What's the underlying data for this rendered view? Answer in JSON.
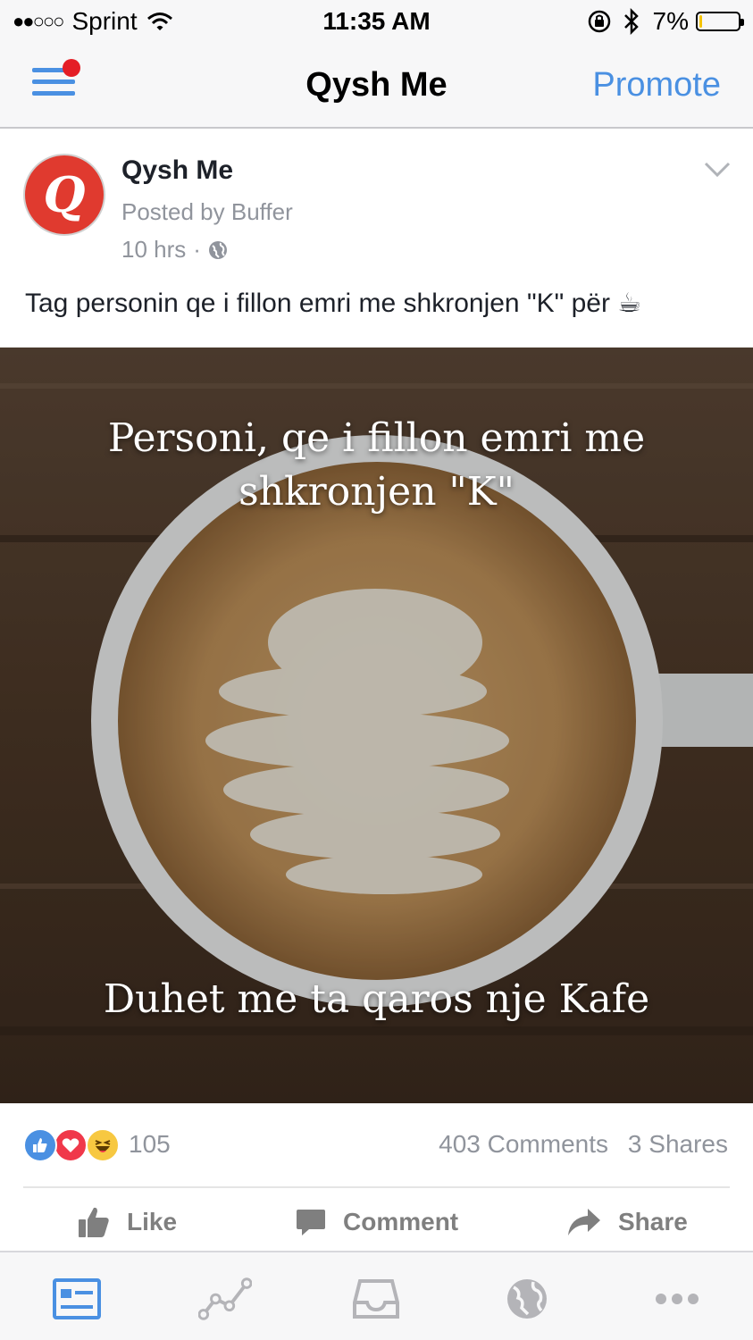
{
  "status_bar": {
    "signal": "●●○○○",
    "carrier": "Sprint",
    "time": "11:35 AM",
    "battery_text": "7%",
    "battery_level": 0.07,
    "icons": [
      "wifi-icon",
      "rotation-lock-icon",
      "bluetooth-icon",
      "battery-icon"
    ]
  },
  "nav": {
    "title": "Qysh Me",
    "action": "Promote",
    "menu_icon": "menu-icon",
    "notification_color": "#e41e26"
  },
  "post": {
    "page_avatar_letter": "Q",
    "page_name": "Qysh Me",
    "posted_by": "Posted by Buffer",
    "time": "10 hrs",
    "separator": "·",
    "privacy_icon": "globe-icon",
    "options_icon": "chevron-down-icon",
    "text": "Tag personin qe i fillon emri me shkronjen \"K\" për ☕",
    "image_text_top_line1": "Personi, qe i fillon emri me",
    "image_text_top_line2": "shkronjen \"K\"",
    "image_text_bottom": "Duhet me ta qaros nje Kafe"
  },
  "engagement": {
    "reaction_icons": [
      "like-reaction-icon",
      "love-reaction-icon",
      "haha-reaction-icon"
    ],
    "reaction_count": "105",
    "comments": "403 Comments",
    "shares": "3 Shares"
  },
  "actions": {
    "like": "Like",
    "comment": "Comment",
    "share": "Share"
  },
  "tab_bar": {
    "tabs": [
      "news-feed-icon",
      "insights-icon",
      "inbox-icon",
      "globe-icon",
      "more-icon"
    ],
    "active_color": "#4a90e2",
    "inactive_color": "#b4b4b8"
  },
  "colors": {
    "accent": "#4a90e2",
    "avatar": "#e03a2f",
    "muted_text": "#90949c"
  }
}
